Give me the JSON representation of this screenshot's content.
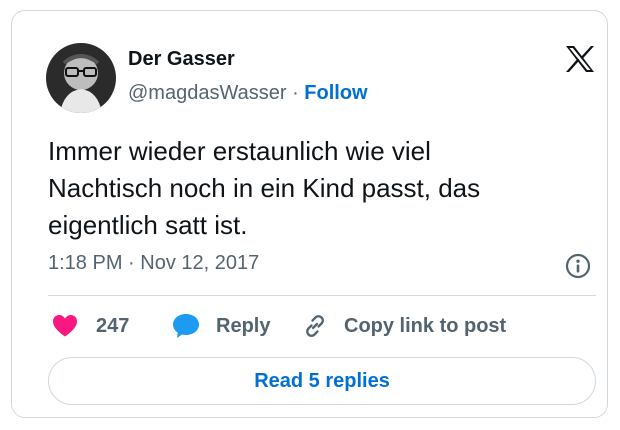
{
  "author": {
    "name": "Der Gasser",
    "handle": "@magdasWasser",
    "separator": "·",
    "follow_label": "Follow"
  },
  "tweet": {
    "lines": [
      "Immer wieder erstaunlich wie viel",
      "Nachtisch noch in ein Kind passt, das",
      "eigentlich satt ist."
    ],
    "time": "1:18 PM",
    "meta_separator": "·",
    "date": "Nov 12, 2017"
  },
  "actions": {
    "like_count": "247",
    "reply_label": "Reply",
    "copy_label": "Copy link to post"
  },
  "read_replies_label": "Read 5 replies",
  "icons": {
    "platform": "x-logo-icon",
    "info": "info-icon",
    "like": "heart-icon",
    "reply": "speech-bubble-icon",
    "copy": "link-icon"
  },
  "colors": {
    "heart": "#f91880",
    "reply_bubble": "#1d9bf0",
    "link_blue": "#006fd6",
    "muted": "#536471",
    "border": "#cfd9de"
  }
}
